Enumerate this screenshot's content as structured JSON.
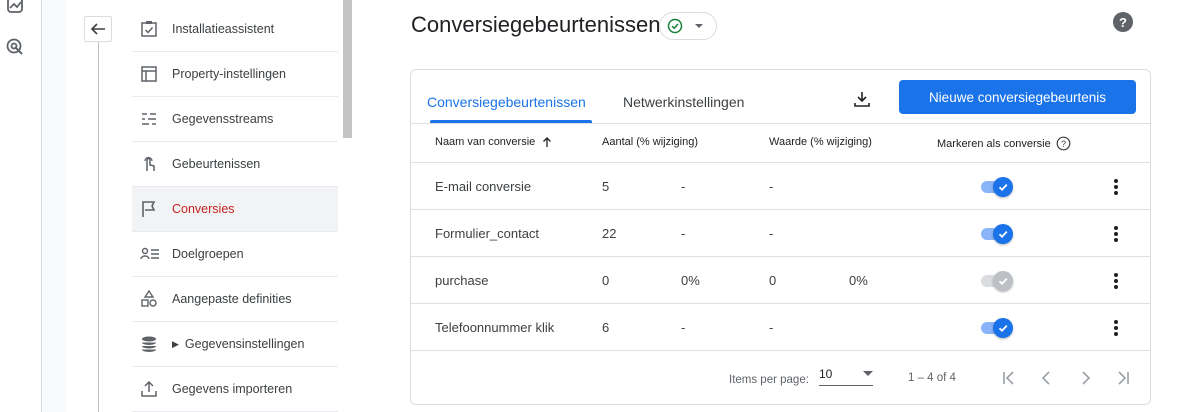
{
  "rail": {
    "icons": [
      "insights-icon",
      "advertising-icon"
    ]
  },
  "nav": {
    "back_label": "",
    "items": [
      {
        "label": "Installatieassistent",
        "icon": "checklist-icon"
      },
      {
        "label": "Property-instellingen",
        "icon": "property-settings-icon"
      },
      {
        "label": "Gegevensstreams",
        "icon": "data-streams-icon"
      },
      {
        "label": "Gebeurtenissen",
        "icon": "touch-icon"
      },
      {
        "label": "Conversies",
        "icon": "flag-icon",
        "active": true
      },
      {
        "label": "Doelgroepen",
        "icon": "audiences-icon"
      },
      {
        "label": "Aangepaste definities",
        "icon": "shapes-icon"
      },
      {
        "label": "Gegevensinstellingen",
        "icon": "database-icon",
        "expandable": true
      },
      {
        "label": "Gegevens importeren",
        "icon": "upload-icon"
      }
    ]
  },
  "header": {
    "title": "Conversiegebeurtenissen",
    "help": "?"
  },
  "tabs": [
    {
      "label": "Conversiegebeurtenissen",
      "active": true
    },
    {
      "label": "Netwerkinstellingen",
      "active": false
    }
  ],
  "actions": {
    "new_button": "Nieuwe conversiegebeurtenis"
  },
  "table": {
    "headers": {
      "name": "Naam van conversie",
      "count": "Aantal (% wijziging)",
      "value": "Waarde (% wijziging)",
      "mark": "Markeren als conversie"
    },
    "rows": [
      {
        "name": "E-mail conversie",
        "count": "5",
        "count_change": "-",
        "value": "-",
        "value_change": "",
        "marked": true
      },
      {
        "name": "Formulier_contact",
        "count": "22",
        "count_change": "-",
        "value": "-",
        "value_change": "",
        "marked": true
      },
      {
        "name": "purchase",
        "count": "0",
        "count_change": "0%",
        "value": "0",
        "value_change": "0%",
        "marked": true,
        "disabled": true
      },
      {
        "name": "Telefoonnummer klik",
        "count": "6",
        "count_change": "-",
        "value": "-",
        "value_change": "",
        "marked": true
      }
    ]
  },
  "pagination": {
    "items_per_page_label": "Items per page:",
    "items_per_page_value": "10",
    "range": "1 – 4 of 4"
  },
  "colors": {
    "accent": "#1a73e8",
    "active_nav_text": "#c5221f",
    "success": "#188038"
  }
}
